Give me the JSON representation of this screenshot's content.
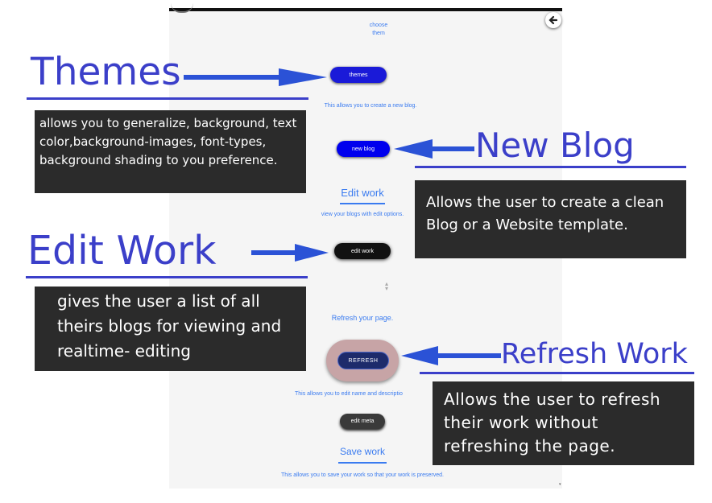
{
  "panel": {
    "choose": "choose",
    "them": "them",
    "themes_button": "themes",
    "new_blog_desc": "This allows you to create a new blog.",
    "new_blog_button": "new blog",
    "edit_work_title": "Edit work",
    "edit_work_desc": "view your blogs with edit options.",
    "edit_work_button": "edit work",
    "refresh_desc": "Refresh your page.",
    "refresh_button": "REFRESH",
    "edit_meta_desc": "This allows you to edit name and descriptio",
    "edit_meta_button": "edit meta",
    "save_work_title": "Save work",
    "save_work_desc": "This allows you to save your work so that your work is preserved."
  },
  "annotations": {
    "themes_heading": "Themes",
    "themes_text": "allows you to generalize, background, text color,background-images, font-types, background shading to you preference.",
    "new_blog_heading": "New Blog",
    "new_blog_text": "Allows the user to create a clean Blog or  a Website template.",
    "edit_work_heading": "Edit Work",
    "edit_work_text": "gives the user a list of all theirs blogs for viewing and realtime- editing",
    "refresh_heading": "Refresh Work",
    "refresh_text": "Allows the user to refresh their work without refreshing the page."
  },
  "colors": {
    "heading": "#3b3fc9",
    "arrow": "#2b52d6",
    "panel_link": "#3a7bf0",
    "themes_btn": "#1a1ad8",
    "new_blog_btn": "#0000ee",
    "refresh_btn": "#1d2b6b",
    "refresh_halo": "#c7a4a6"
  },
  "icons": {
    "back": "back-arrow-circle-icon",
    "sort": "sort-arrows-icon"
  }
}
